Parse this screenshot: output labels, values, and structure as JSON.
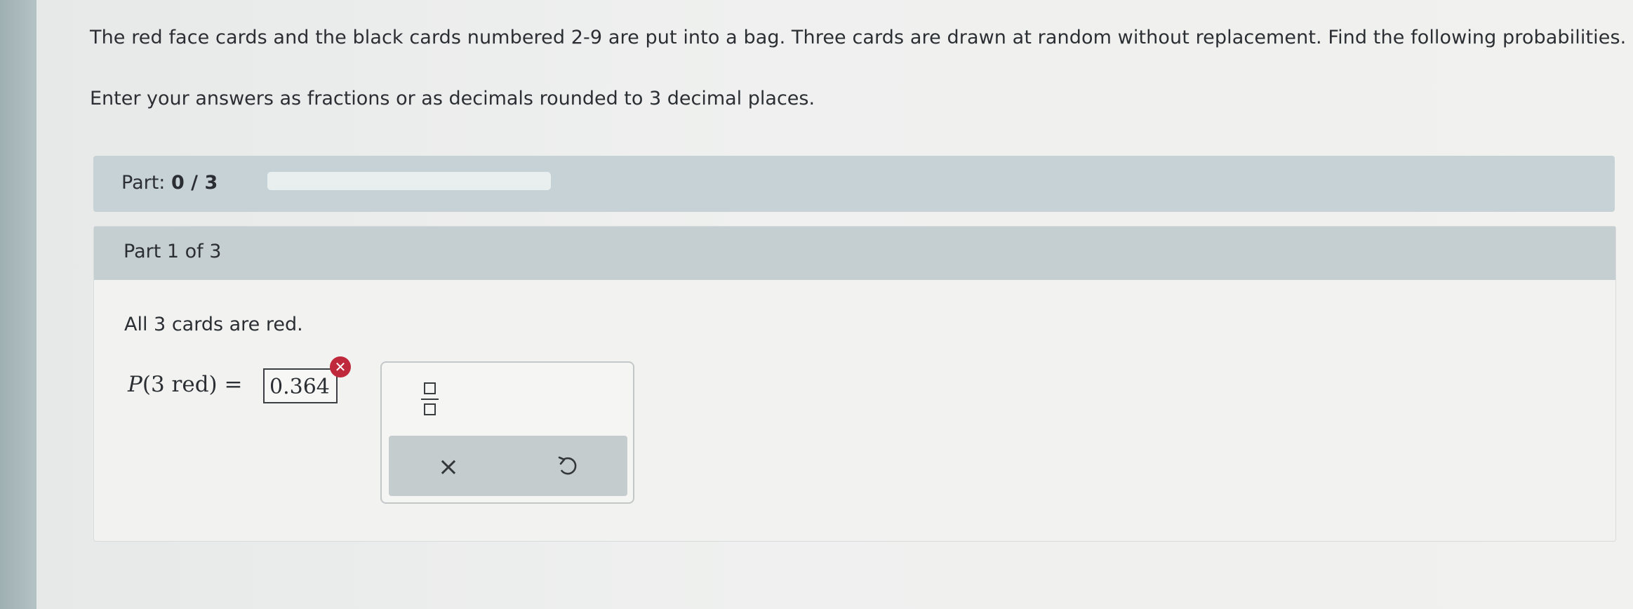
{
  "problem": {
    "text": "The red face cards and the black cards numbered 2-9 are put into a bag. Three cards are drawn at random without replacement. Find the following probabilities.",
    "instruction": "Enter your answers as fractions or as decimals rounded to 3 decimal places."
  },
  "progress": {
    "label": "Part:",
    "value": "0 / 3",
    "fraction": 0
  },
  "part": {
    "header": "Part 1 of 3",
    "question": "All 3 cards are red.",
    "math_lhs_p": "P",
    "math_lhs_arg": "(3 red)",
    "math_equals": "=",
    "answer": "0.364",
    "error_icon": "error-x-icon"
  },
  "tools": {
    "fraction_icon": "fraction-template-icon",
    "clear_symbol": "×",
    "clear_icon": "close-icon",
    "undo_icon": "undo-icon"
  },
  "colors": {
    "error": "#c0283c",
    "header_bg": "#c5ced0",
    "progress_bg": "#c7d2d6"
  }
}
